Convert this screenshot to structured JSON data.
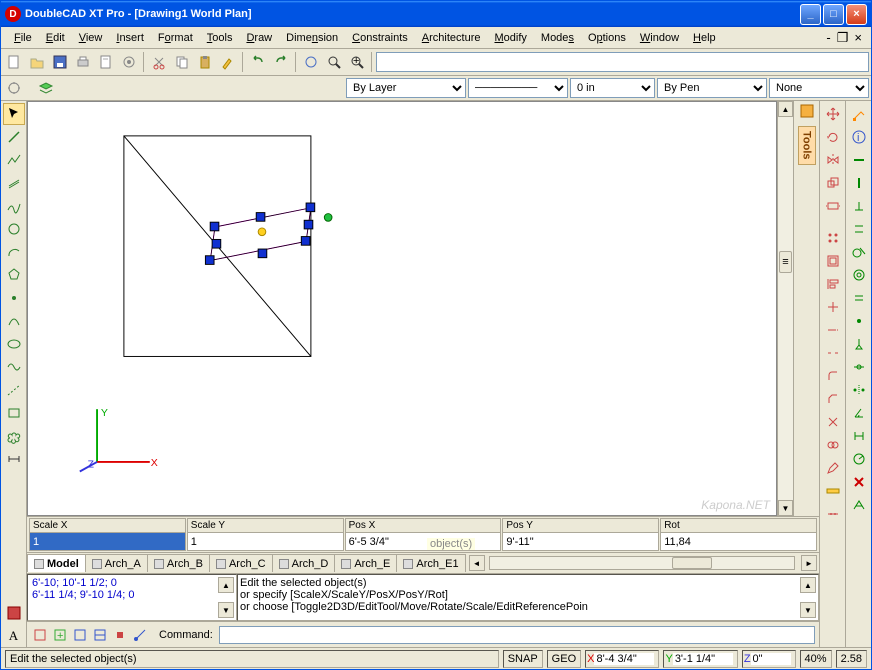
{
  "titlebar": {
    "title": "DoubleCAD XT Pro - [Drawing1 World Plan]",
    "app_initial": "D"
  },
  "menu": {
    "file": "File",
    "edit": "Edit",
    "view": "View",
    "insert": "Insert",
    "format": "Format",
    "tools": "Tools",
    "draw": "Draw",
    "dimension": "Dimension",
    "constraints": "Constraints",
    "architecture": "Architecture",
    "modify": "Modify",
    "modes": "Modes",
    "options": "Options",
    "window": "Window",
    "help": "Help"
  },
  "propbar": {
    "layer": "By Layer",
    "lineweight": "0 in",
    "pen": "By Pen",
    "none": "None"
  },
  "fields": {
    "scalex": {
      "label": "Scale X",
      "value": "1"
    },
    "scaley": {
      "label": "Scale Y",
      "value": "1"
    },
    "posx": {
      "label": "Pos X",
      "value": "6'-5 3/4\""
    },
    "posy": {
      "label": "Pos Y",
      "value": "9'-11\""
    },
    "rot": {
      "label": "Rot",
      "value": "11,84"
    }
  },
  "field_hint": "object(s)",
  "tabs": {
    "model": "Model",
    "a": "Arch_A",
    "b": "Arch_B",
    "c": "Arch_C",
    "d": "Arch_D",
    "e": "Arch_E",
    "e1": "Arch_E1"
  },
  "history": {
    "line1": "6'-10; 10'-1 1/2; 0",
    "line2": "6'-11 1/4; 9'-10 1/4; 0"
  },
  "output": {
    "line1": "Edit the selected object(s)",
    "line2": "  or specify [ScaleX/ScaleY/PosX/PosY/Rot]",
    "line3": "  or choose [Toggle2D3D/EditTool/Move/Rotate/Scale/EditReferencePoin"
  },
  "command": {
    "label": "Command:",
    "value": ""
  },
  "status": {
    "msg": "Edit the selected object(s)",
    "snap": "SNAP",
    "geo": "GEO",
    "x_label": "X",
    "x": "8'-4 3/4\"",
    "y_label": "Y",
    "y": "3'-1 1/4\"",
    "z_label": "Z",
    "z": "0\"",
    "zoom": "40%",
    "extra": "2.58"
  },
  "axes": {
    "x": "X",
    "y": "Y",
    "z": "Z"
  },
  "tools_tab": "Tools",
  "watermark": "Kapona.NET"
}
